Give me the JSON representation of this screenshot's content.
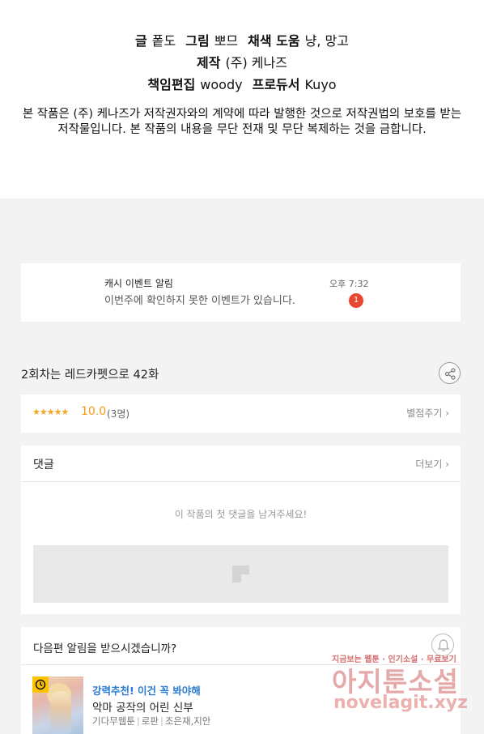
{
  "credits": {
    "line1": {
      "l1": "글",
      "v1": "퐅도",
      "l2": "그림",
      "v2": "뽀므",
      "l3": "채색 도움",
      "v3": "냥, 망고"
    },
    "line2": {
      "l1": "제작",
      "v1": "(주) 케나즈"
    },
    "line3": {
      "l1": "책임편집",
      "v1": "woody",
      "l2": "프로듀서",
      "v2": "Kuyo"
    },
    "copyright": "본 작품은 (주) 케나즈가 저작권자와의 계약에 따라 발행한 것으로 저작권법의 보호를 받는 저작물입니다. 본 작품의 내용을 무단 전재 및 무단 복제하는 것을 금합니다."
  },
  "cash_event": {
    "title": "캐시 이벤트 알림",
    "time": "오후 7:32",
    "message": "이번주에 확인하지 못한 이벤트가 있습니다.",
    "badge": "1"
  },
  "episode": {
    "title": "2회차는 레드카펫으로 42화",
    "share_icon": "share-icon"
  },
  "rating": {
    "stars": "★★★★★",
    "score": "10.0",
    "votes": "(3명)",
    "rate_link": "별점주기 ›"
  },
  "comments": {
    "title": "댓글",
    "more": "더보기 ›",
    "empty": "이 작품의 첫 댓글을 남겨주세요!"
  },
  "next_alert": {
    "question": "다음편 알림을 받으시겠습니까?",
    "bell_icon": "bell-icon"
  },
  "recommend": {
    "label": "강력추천! 이건 꼭 봐야해",
    "title": "악마 공작의 어린 신부",
    "genre": "기다무웹툰",
    "category": "로판",
    "authors": "조은재,지안"
  },
  "watermark": {
    "top": "지금보는 웹툰 · 인기소설 · 무료보기",
    "main": "아지툰소설",
    "url": "novelagit.xyz"
  },
  "colors": {
    "accent_orange": "#f39c12",
    "badge_red": "#e8462f",
    "link_blue": "#2a7bd1",
    "page_gray": "#f3f3f3"
  }
}
